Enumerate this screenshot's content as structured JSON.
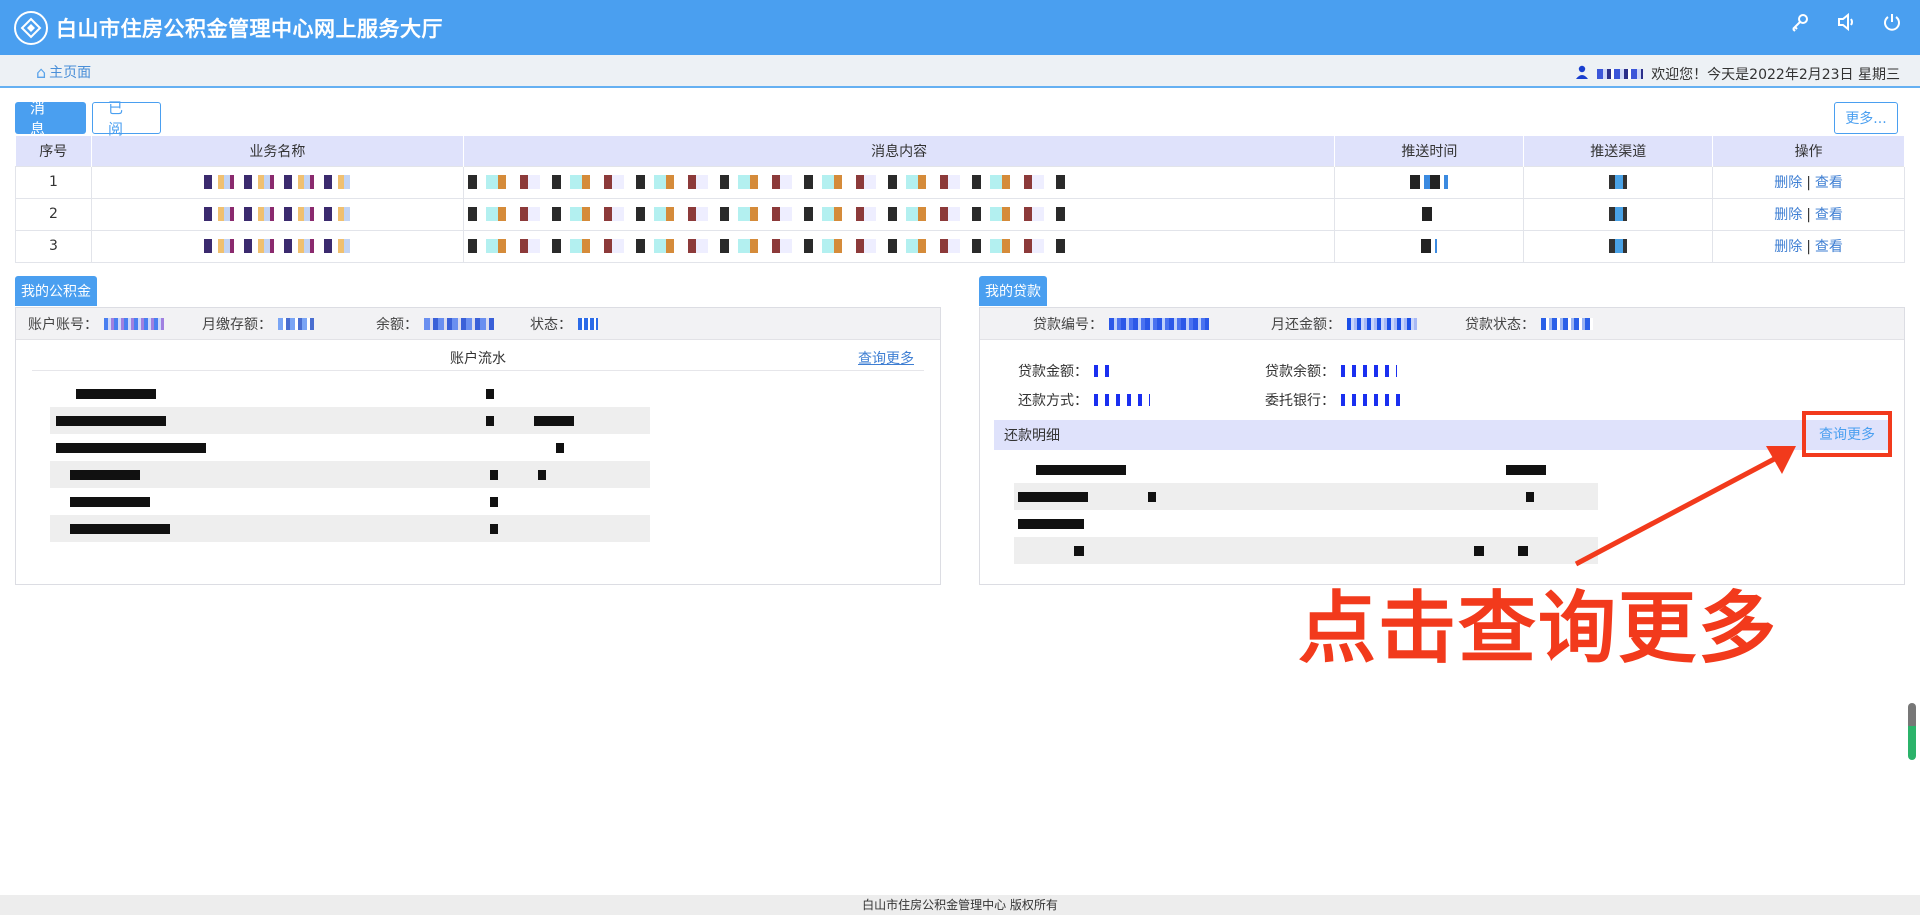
{
  "header": {
    "title": "白山市住房公积金管理中心网上服务大厅",
    "icons": [
      "key-icon",
      "speaker-icon",
      "power-icon"
    ]
  },
  "subbar": {
    "home_label": "主页面",
    "welcome": "欢迎您！今天是2022年2月23日 星期三"
  },
  "tabs": [
    {
      "label": "消 息",
      "active": true
    },
    {
      "label": "已 阅",
      "active": false
    }
  ],
  "more_button": "更多...",
  "message_table": {
    "headers": [
      "序号",
      "业务名称",
      "消息内容",
      "推送时间",
      "推送渠道",
      "操作"
    ],
    "rows": [
      {
        "index": "1",
        "delete": "删除",
        "view": "查看"
      },
      {
        "index": "2",
        "delete": "删除",
        "view": "查看"
      },
      {
        "index": "3",
        "delete": "删除",
        "view": "查看"
      }
    ],
    "separator": "|"
  },
  "fund": {
    "tag": "我的公积金",
    "account_label": "账户账号：",
    "monthly_label": "月缴存额：",
    "balance_label": "余额：",
    "status_label": "状态：",
    "flow_title": "账户流水",
    "flow_more": "查询更多"
  },
  "loan": {
    "tag": "我的贷款",
    "loan_no_label": "贷款编号：",
    "monthly_repay_label": "月还金额：",
    "loan_status_label": "贷款状态：",
    "amount_label": "贷款金额：",
    "balance_label": "贷款余额：",
    "method_label": "还款方式：",
    "bank_label": "委托银行：",
    "repay_detail": "还款明细",
    "repay_more": "查询更多"
  },
  "annotation": {
    "text": "点击查询更多",
    "color": "#f23a1c"
  },
  "footer": "白山市住房公积金管理中心 版权所有",
  "colors": {
    "primary": "#4a9ff0",
    "header_row": "#dfe2fb",
    "link": "#3f7fd3"
  }
}
